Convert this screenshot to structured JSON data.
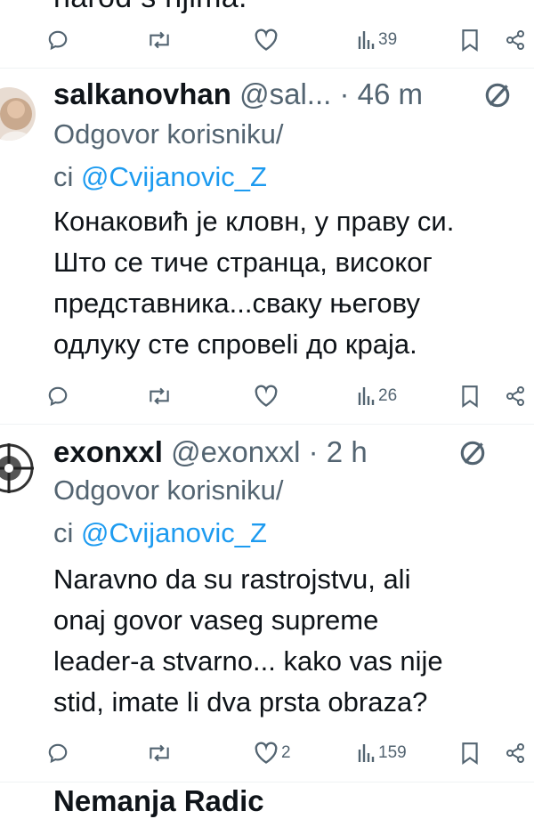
{
  "top_fragment": "narod s njima.",
  "tweets": [
    {
      "name": "salkanovhan",
      "handle": "@sal...",
      "time": "· 46 m",
      "reply_prefix": "Odgovor korisniku/",
      "reply_prefix2": "ci ",
      "reply_mention": "@Cvijanovic_Z",
      "body": [
        "Конаковић је кловн, у праву си.",
        "Што се тиче странца, високог",
        "представника...сваку његову",
        "одлуку сте спровеli до краја."
      ],
      "views": "26",
      "likes": ""
    },
    {
      "name": "exonxxl",
      "handle": "@exonxxl · 2 h",
      "time": "",
      "reply_prefix": "Odgovor korisniku/",
      "reply_prefix2": "ci ",
      "reply_mention": "@Cvijanovic_Z",
      "body": [
        "Naravno da su rastrojstvu, ali",
        "onaj govor vaseg supreme",
        "leader-a  stvarno... kako vas nije",
        "stid, imate li dva prsta obraza?"
      ],
      "views": "159",
      "likes": "2"
    }
  ],
  "top_views": "39",
  "bottom_fragment": "Nemanja Radic",
  "colors": {
    "text": "#0f1419",
    "muted": "#536471",
    "link": "#1d9bf0",
    "divider": "#eff3f4"
  }
}
